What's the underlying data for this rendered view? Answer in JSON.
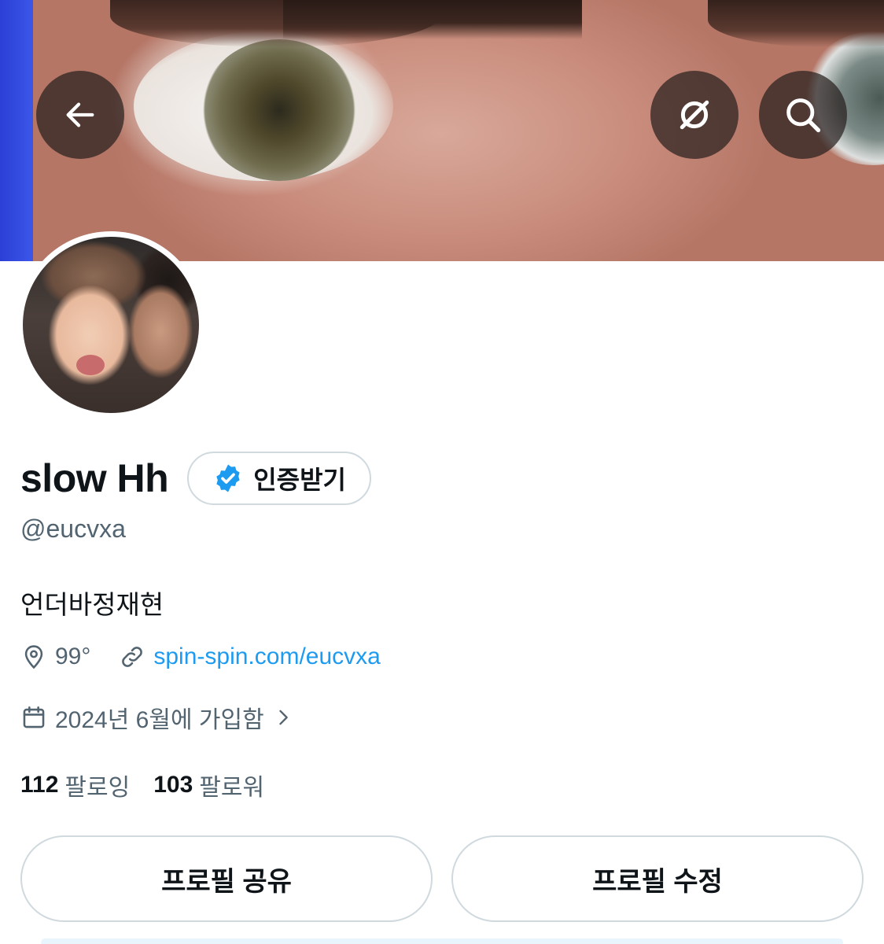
{
  "header": {
    "back_icon": "arrow-left-icon",
    "grok_icon": "grok-icon",
    "search_icon": "search-icon",
    "overlay_color": "#28201e"
  },
  "profile": {
    "display_name": "slow Hh",
    "verify_label": "인증받기",
    "verify_icon": "verified-badge-icon",
    "verify_color": "#1d9bf0",
    "handle": "@eucvxa",
    "bio": "언더바정재현",
    "location_icon": "location-pin-icon",
    "location": "99°",
    "link_icon": "link-icon",
    "website": "spin-spin.com/eucvxa",
    "link_color": "#1d9bf0",
    "calendar_icon": "calendar-icon",
    "joined": "2024년 6월에 가입함",
    "joined_chevron_icon": "chevron-right-icon"
  },
  "stats": {
    "following_count": "112",
    "following_label": "팔로잉",
    "followers_count": "103",
    "followers_label": "팔로워"
  },
  "actions": {
    "share_label": "프로필 공유",
    "edit_label": "프로필 수정"
  }
}
